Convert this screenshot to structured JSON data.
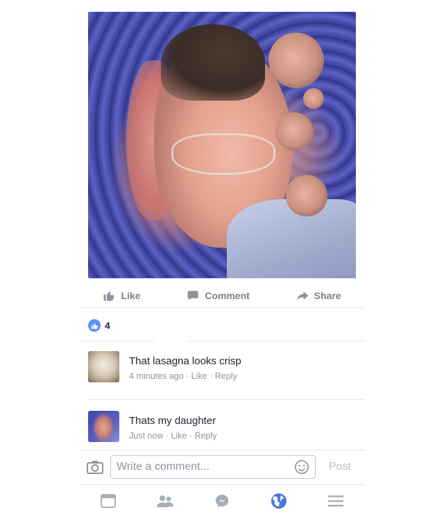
{
  "post": {
    "image_alt": "distorted spiral face image"
  },
  "actions": {
    "like_label": "Like",
    "comment_label": "Comment",
    "share_label": "Share"
  },
  "reactions": {
    "count": "4"
  },
  "comments": [
    {
      "text": "That lasagna looks crisp",
      "time": "4 minutes ago",
      "like": "Like",
      "reply": "Reply",
      "sep": "·"
    },
    {
      "text": "Thats my daughter",
      "time": "Just now",
      "like": "Like",
      "reply": "Reply",
      "sep": "·"
    }
  ],
  "composer": {
    "placeholder": "Write a comment...",
    "post_label": "Post"
  },
  "tabbar": {
    "active": "globe-icon"
  },
  "colors": {
    "accent": "#4267b2",
    "like_blue": "#5890ff",
    "muted": "#90949c"
  }
}
